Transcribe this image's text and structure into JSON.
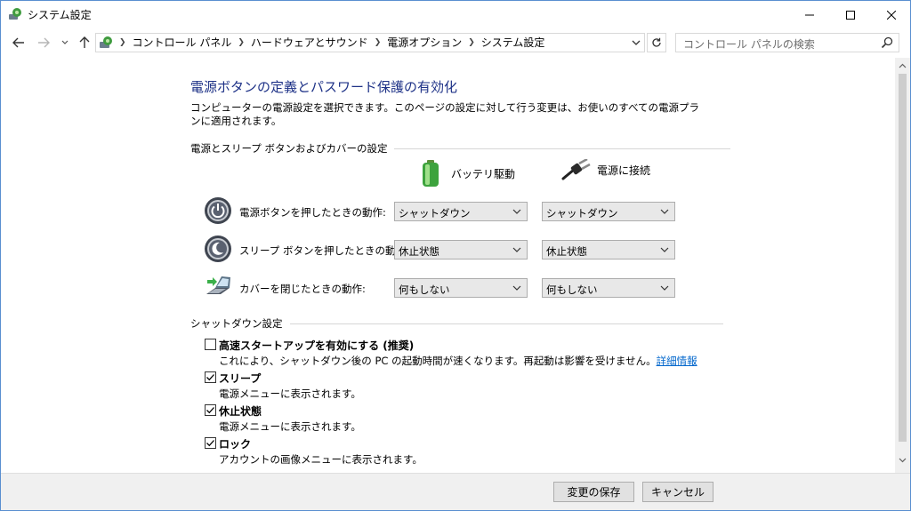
{
  "window": {
    "title": "システム設定"
  },
  "address": {
    "crumbs": [
      "コントロール パネル",
      "ハードウェアとサウンド",
      "電源オプション",
      "システム設定"
    ]
  },
  "search": {
    "placeholder": "コントロール パネルの検索"
  },
  "page": {
    "heading": "電源ボタンの定義とパスワード保護の有効化",
    "description": "コンピューターの電源設定を選択できます。このページの設定に対して行う変更は、お使いのすべての電源プランに適用されます。"
  },
  "power_section": {
    "title": "電源とスリープ ボタンおよびカバーの設定",
    "col_battery": "バッテリ駆動",
    "col_plugged": "電源に接続",
    "rows": [
      {
        "label": "電源ボタンを押したときの動作:",
        "battery": "シャットダウン",
        "plugged": "シャットダウン",
        "icon": "power-button-icon"
      },
      {
        "label": "スリープ ボタンを押したときの動作:",
        "battery": "休止状態",
        "plugged": "休止状態",
        "icon": "sleep-button-icon"
      },
      {
        "label": "カバーを閉じたときの動作:",
        "battery": "何もしない",
        "plugged": "何もしない",
        "icon": "laptop-lid-icon"
      }
    ]
  },
  "shutdown_section": {
    "title": "シャットダウン設定",
    "items": [
      {
        "label": "高速スタートアップを有効にする (推奨)",
        "desc": "これにより、シャットダウン後の PC の起動時間が速くなります。再起動は影響を受けません。",
        "link": "詳細情報",
        "checked": false
      },
      {
        "label": "スリープ",
        "desc": "電源メニューに表示されます。",
        "checked": true
      },
      {
        "label": "休止状態",
        "desc": "電源メニューに表示されます。",
        "checked": true
      },
      {
        "label": "ロック",
        "desc": "アカウントの画像メニューに表示されます。",
        "checked": true
      }
    ]
  },
  "footer": {
    "save_label": "変更の保存",
    "cancel_label": "キャンセル"
  },
  "colors": {
    "heading": "#1e3287",
    "link": "#0066cc",
    "window_border": "#5a8fd0"
  }
}
